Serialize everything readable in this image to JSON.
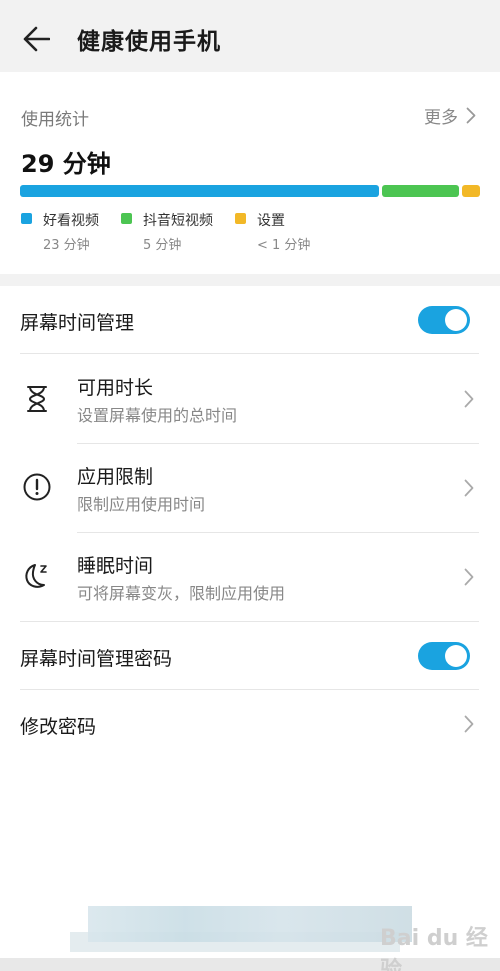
{
  "header": {
    "title": "健康使用手机"
  },
  "stats": {
    "label": "使用统计",
    "more": "更多",
    "total": "29 分钟",
    "bar": [
      {
        "color": "#1aa3e0",
        "fraction": 0.79
      },
      {
        "color": "#4cc552",
        "fraction": 0.17
      },
      {
        "color": "#f2b827",
        "fraction": 0.04
      }
    ],
    "apps": [
      {
        "name": "好看视频",
        "duration": "23 分钟",
        "color": "#1aa3e0"
      },
      {
        "name": "抖音短视频",
        "duration": "5 分钟",
        "color": "#4cc552"
      },
      {
        "name": "设置",
        "duration": "< 1 分钟",
        "color": "#f2b827"
      }
    ]
  },
  "settings": {
    "screen_time": {
      "label": "屏幕时间管理",
      "enabled": true
    },
    "items": [
      {
        "title": "可用时长",
        "subtitle": "设置屏幕使用的总时间",
        "icon": "hourglass-icon"
      },
      {
        "title": "应用限制",
        "subtitle": "限制应用使用时间",
        "icon": "exclamation-circle-icon"
      },
      {
        "title": "睡眠时间",
        "subtitle": "可将屏幕变灰，限制应用使用",
        "icon": "moon-sleep-icon"
      }
    ],
    "password": {
      "label": "屏幕时间管理密码",
      "enabled": true
    },
    "change_password": {
      "label": "修改密码"
    }
  },
  "colors": {
    "toggle_on": "#1aa3e0"
  },
  "watermark": "Bai du 经验"
}
